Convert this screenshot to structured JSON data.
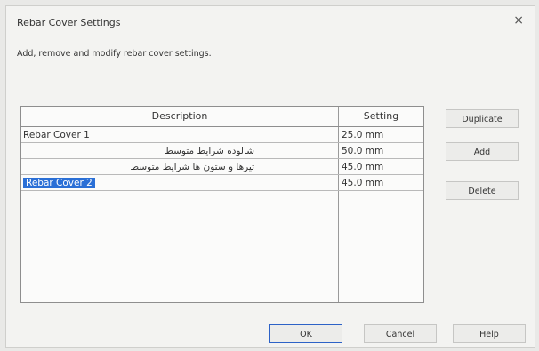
{
  "dialog": {
    "title": "Rebar Cover Settings",
    "close_glyph": "×",
    "instructions": "Add, remove and modify rebar cover settings."
  },
  "table": {
    "headers": {
      "description": "Description",
      "setting": "Setting"
    },
    "rows": [
      {
        "description": "Rebar Cover 1",
        "setting": "25.0 mm"
      },
      {
        "description": "شالوده شرایط متوسط",
        "setting": "50.0 mm"
      },
      {
        "description": "تیرها و ستون ها شرایط متوسط",
        "setting": "45.0 mm"
      },
      {
        "description": "Rebar Cover 2",
        "setting": "45.0 mm",
        "selected": true
      }
    ]
  },
  "side_buttons": {
    "duplicate": "Duplicate",
    "add": "Add",
    "delete": "Delete"
  },
  "footer_buttons": {
    "ok": "OK",
    "cancel": "Cancel",
    "help": "Help"
  },
  "colors": {
    "selection": "#2a6fd6",
    "ok_border": "#2d62c7"
  }
}
